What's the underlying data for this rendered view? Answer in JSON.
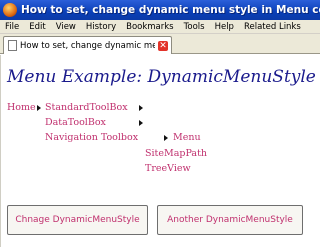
{
  "window": {
    "title": "How to set, change dynamic menu style in Menu control programmatio",
    "icon": "firefox-icon"
  },
  "menubar": {
    "items": [
      "File",
      "Edit",
      "View",
      "History",
      "Bookmarks",
      "Tools",
      "Help",
      "Related Links"
    ]
  },
  "tab": {
    "label": "How to set, change dynamic men...",
    "close_icon": "close-icon"
  },
  "page": {
    "title": "Menu Example: DynamicMenuStyle",
    "menu": {
      "home": "Home",
      "level1": [
        "StandardToolBox",
        "DataToolBox",
        "Navigation Toolbox"
      ],
      "level2": [
        "Menu",
        "SiteMapPath",
        "TreeView"
      ]
    },
    "buttons": {
      "change": "Chnage DynamicMenuStyle",
      "another": "Another DynamicMenuStyle"
    }
  },
  "colors": {
    "title_blue": "#1a1a8c",
    "link_pink": "#c0306e",
    "titlebar_blue": "#0a3fb7"
  }
}
